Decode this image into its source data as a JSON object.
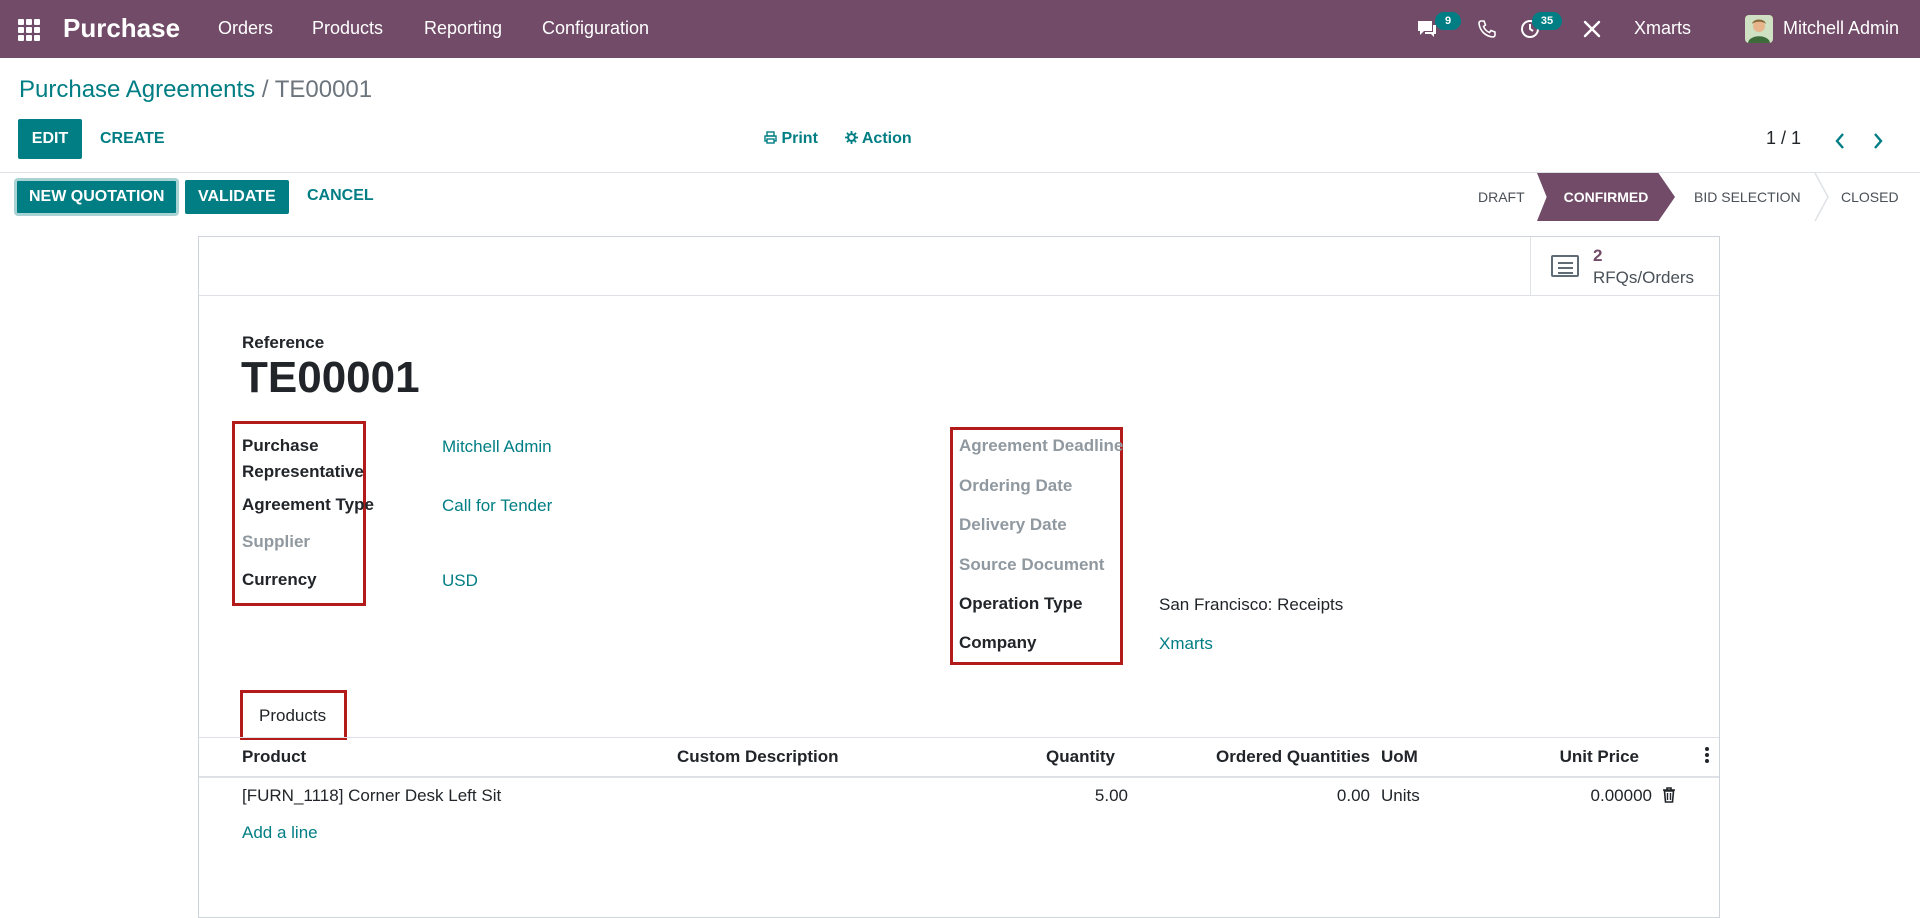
{
  "navbar": {
    "app_name": "Purchase",
    "menu": [
      "Orders",
      "Products",
      "Reporting",
      "Configuration"
    ],
    "messages_count": "9",
    "activities_count": "35",
    "company": "Xmarts",
    "user": "Mitchell Admin",
    "icons": [
      "apps-grid-icon",
      "chat-icon",
      "phone-icon",
      "clock-icon",
      "tools-icon",
      "avatar"
    ]
  },
  "breadcrumb": {
    "parent": "Purchase Agreements",
    "separator": "/",
    "current": "TE00001"
  },
  "toolbar": {
    "edit": "EDIT",
    "create": "CREATE",
    "print": "Print",
    "action": "Action",
    "pager": "1 / 1"
  },
  "statusbar": {
    "new_quotation": "NEW QUOTATION",
    "validate": "VALIDATE",
    "cancel": "CANCEL",
    "stages": [
      "DRAFT",
      "CONFIRMED",
      "BID SELECTION",
      "CLOSED"
    ],
    "active_stage": "CONFIRMED"
  },
  "smart_button": {
    "count": "2",
    "label": "RFQs/Orders"
  },
  "form": {
    "reference_label": "Reference",
    "reference": "TE00001",
    "left": {
      "purchase_rep_label_1": "Purchase",
      "purchase_rep_label_2": "Representative",
      "purchase_rep": "Mitchell Admin",
      "agreement_type_label": "Agreement Type",
      "agreement_type": "Call for Tender",
      "supplier_label": "Supplier",
      "currency_label": "Currency",
      "currency": "USD"
    },
    "right": {
      "deadline_label": "Agreement Deadline",
      "ordering_date_label": "Ordering Date",
      "delivery_date_label": "Delivery Date",
      "source_document_label": "Source Document",
      "operation_type_label": "Operation Type",
      "operation_type": "San Francisco: Receipts",
      "company_label": "Company",
      "company": "Xmarts"
    }
  },
  "tabs": {
    "products": "Products"
  },
  "table": {
    "headers": {
      "product": "Product",
      "custom_description": "Custom Description",
      "quantity": "Quantity",
      "ordered_quantities": "Ordered Quantities",
      "uom": "UoM",
      "unit_price": "Unit Price"
    },
    "rows": [
      {
        "product": "[FURN_1118] Corner Desk Left Sit",
        "custom_description": "",
        "quantity": "5.00",
        "ordered_quantities": "0.00",
        "uom": "Units",
        "unit_price": "0.00000"
      }
    ],
    "add_line": "Add a line"
  }
}
